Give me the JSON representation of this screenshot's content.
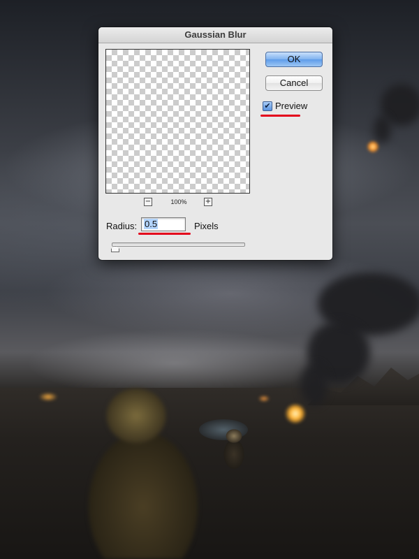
{
  "dialog": {
    "title": "Gaussian Blur",
    "ok_label": "OK",
    "cancel_label": "Cancel",
    "preview": {
      "label": "Preview",
      "checked": true,
      "check_glyph": "✔"
    },
    "zoom": {
      "level": "100%",
      "zoom_out_glyph": "−",
      "zoom_in_glyph": "+"
    },
    "radius": {
      "label": "Radius:",
      "value": "0.5",
      "units": "Pixels",
      "slider_fraction": 0.0
    }
  },
  "annotations": {
    "highlight_color": "#e3001b"
  },
  "colors": {
    "ok_button": "#6aa6ec",
    "dialog_bg": "#e8e8e8"
  }
}
